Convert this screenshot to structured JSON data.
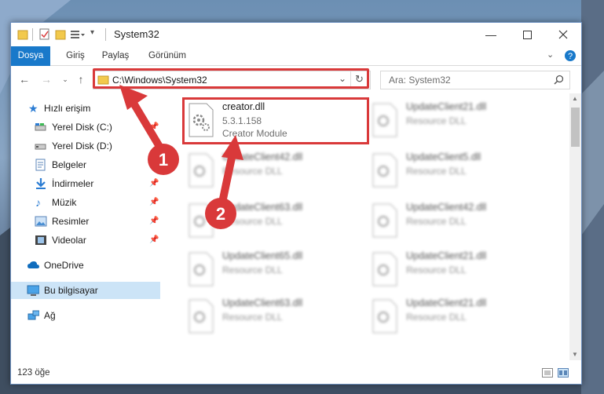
{
  "window": {
    "title": "System32"
  },
  "ribbon": {
    "tabs": [
      "Dosya",
      "Giriş",
      "Paylaş",
      "Görünüm"
    ]
  },
  "address": {
    "path": "C:\\Windows\\System32"
  },
  "search": {
    "placeholder": "Ara: System32"
  },
  "sidebar": {
    "items": [
      {
        "label": "Hızlı erişim",
        "icon": "star-icon"
      },
      {
        "label": "Yerel Disk (C:)",
        "icon": "drive-icon"
      },
      {
        "label": "Yerel Disk (D:)",
        "icon": "drive-icon"
      },
      {
        "label": "Belgeler",
        "icon": "documents-icon"
      },
      {
        "label": "İndirmeler",
        "icon": "download-icon"
      },
      {
        "label": "Müzik",
        "icon": "music-icon"
      },
      {
        "label": "Resimler",
        "icon": "pictures-icon"
      },
      {
        "label": "Videolar",
        "icon": "video-icon"
      },
      {
        "label": "OneDrive",
        "icon": "cloud-icon"
      },
      {
        "label": "Bu bilgisayar",
        "icon": "computer-icon"
      },
      {
        "label": "Ağ",
        "icon": "network-icon"
      }
    ]
  },
  "files": {
    "featured": {
      "name": "creator.dll",
      "version": "5.3.1.158",
      "description": "Creator Module"
    },
    "blurred": [
      {
        "name": "UpdateClient21.dll",
        "type": "Resource DLL"
      },
      {
        "name": "UpdateClient42.dll",
        "type": "Resource DLL"
      },
      {
        "name": "UpdateClient5.dll",
        "type": "Resource DLL"
      },
      {
        "name": "UpdateClient63.dll",
        "type": "Resource DLL"
      },
      {
        "name": "UpdateClient42.dll",
        "type": "Resource DLL"
      },
      {
        "name": "UpdateClient65.dll",
        "type": "Resource DLL"
      },
      {
        "name": "UpdateClient21.dll",
        "type": "Resource DLL"
      },
      {
        "name": "UpdateClient63.dll",
        "type": "Resource DLL"
      },
      {
        "name": "UpdateClient21.dll",
        "type": "Resource DLL"
      }
    ]
  },
  "status": {
    "count": "123 öğe"
  },
  "annotations": {
    "step1": "1",
    "step2": "2"
  },
  "colors": {
    "accent": "#1979ca",
    "highlight": "#d9393a",
    "selection": "#cce4f7"
  }
}
